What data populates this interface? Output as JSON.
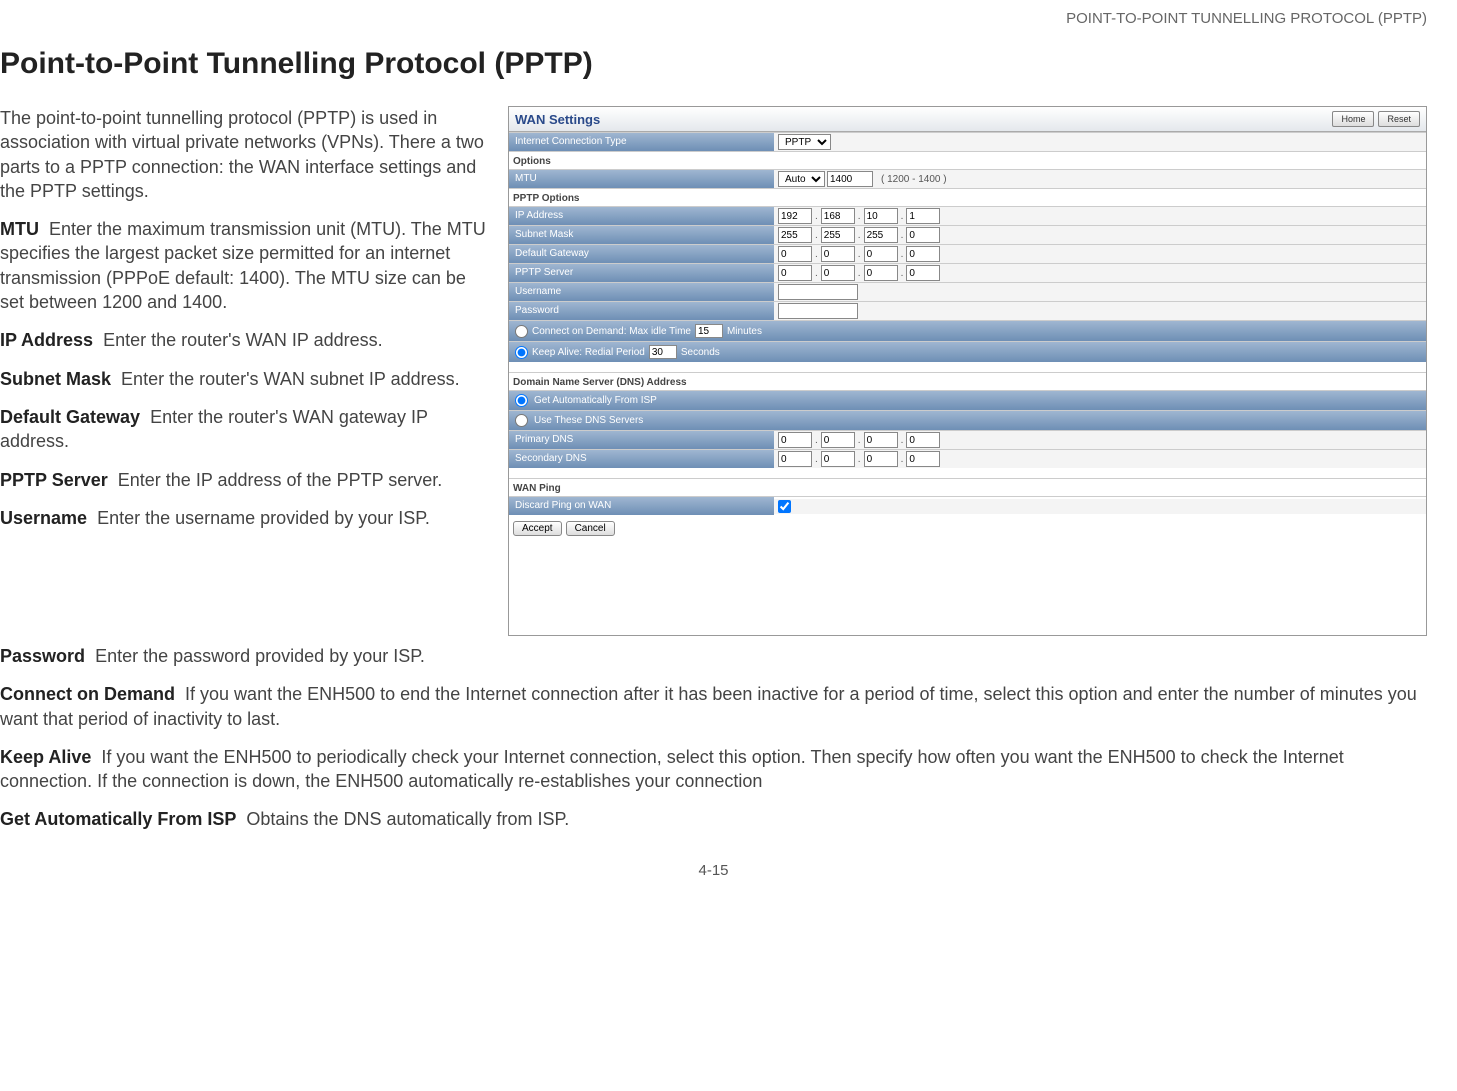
{
  "header_small": "POINT-TO-POINT TUNNELLING PROTOCOL (PPTP)",
  "title": "Point-to-Point Tunnelling Protocol (PPTP)",
  "intro": "The point-to-point tunnelling protocol (PPTP) is used in association with virtual private networks (VPNs). There a two parts to a PPTP connection: the WAN interface settings and the PPTP settings.",
  "defs": {
    "mtu": {
      "term": "MTU",
      "desc": "Enter the maximum transmission unit (MTU). The MTU specifies the largest packet size permitted for an internet transmission (PPPoE default: 1400). The MTU size can be set between 1200 and 1400."
    },
    "ip": {
      "term": "IP Address",
      "desc": "Enter the router's WAN IP address."
    },
    "subnet": {
      "term": "Subnet Mask",
      "desc": "Enter the router's WAN subnet IP address."
    },
    "gateway": {
      "term": "Default Gateway",
      "desc": "Enter the router's WAN gateway IP address."
    },
    "pptp": {
      "term": "PPTP Server",
      "desc": "Enter the IP address of the PPTP server."
    },
    "user": {
      "term": "Username",
      "desc": "Enter the username provided by your ISP."
    },
    "pass": {
      "term": "Password",
      "desc": "Enter the password provided by your ISP."
    },
    "cod": {
      "term": "Connect on Demand",
      "desc": "If you want the ENH500 to end the Internet connection after it has been inactive for a period of time, select this option and enter the number of minutes you want that period of inactivity to last."
    },
    "keep": {
      "term": "Keep Alive",
      "desc": "If you want the ENH500 to periodically check your Internet connection, select this option. Then specify how often you want the ENH500 to check the Internet connection. If the connection is down, the ENH500 automatically re-establishes your connection"
    },
    "auto": {
      "term": "Get Automatically From ISP",
      "desc": "Obtains the DNS automatically from ISP."
    }
  },
  "footer": "4-15",
  "shot": {
    "title": "WAN Settings",
    "home": "Home",
    "reset": "Reset",
    "ict_label": "Internet Connection Type",
    "ict_value": "PPTP",
    "options_label": "Options",
    "mtu_label": "MTU",
    "mtu_mode": "Auto",
    "mtu_value": "1400",
    "mtu_hint": "( 1200 - 1400 )",
    "pptp_opts": "PPTP Options",
    "ip_label": "IP Address",
    "ip": [
      "192",
      "168",
      "10",
      "1"
    ],
    "sm_label": "Subnet Mask",
    "sm": [
      "255",
      "255",
      "255",
      "0"
    ],
    "gw_label": "Default Gateway",
    "gw": [
      "0",
      "0",
      "0",
      "0"
    ],
    "srv_label": "PPTP Server",
    "srv": [
      "0",
      "0",
      "0",
      "0"
    ],
    "user_label": "Username",
    "pass_label": "Password",
    "cod_label_a": "Connect on Demand: Max idle Time",
    "cod_val": "15",
    "cod_label_b": "Minutes",
    "ka_label_a": "Keep Alive: Redial Period",
    "ka_val": "30",
    "ka_label_b": "Seconds",
    "dns_section": "Domain Name Server (DNS) Address",
    "dns_auto": "Get Automatically From ISP",
    "dns_use": "Use These DNS Servers",
    "pdns_label": "Primary DNS",
    "pdns": [
      "0",
      "0",
      "0",
      "0"
    ],
    "sdns_label": "Secondary DNS",
    "sdns": [
      "0",
      "0",
      "0",
      "0"
    ],
    "wanping_section": "WAN Ping",
    "discard_label": "Discard Ping on WAN",
    "accept": "Accept",
    "cancel": "Cancel"
  }
}
